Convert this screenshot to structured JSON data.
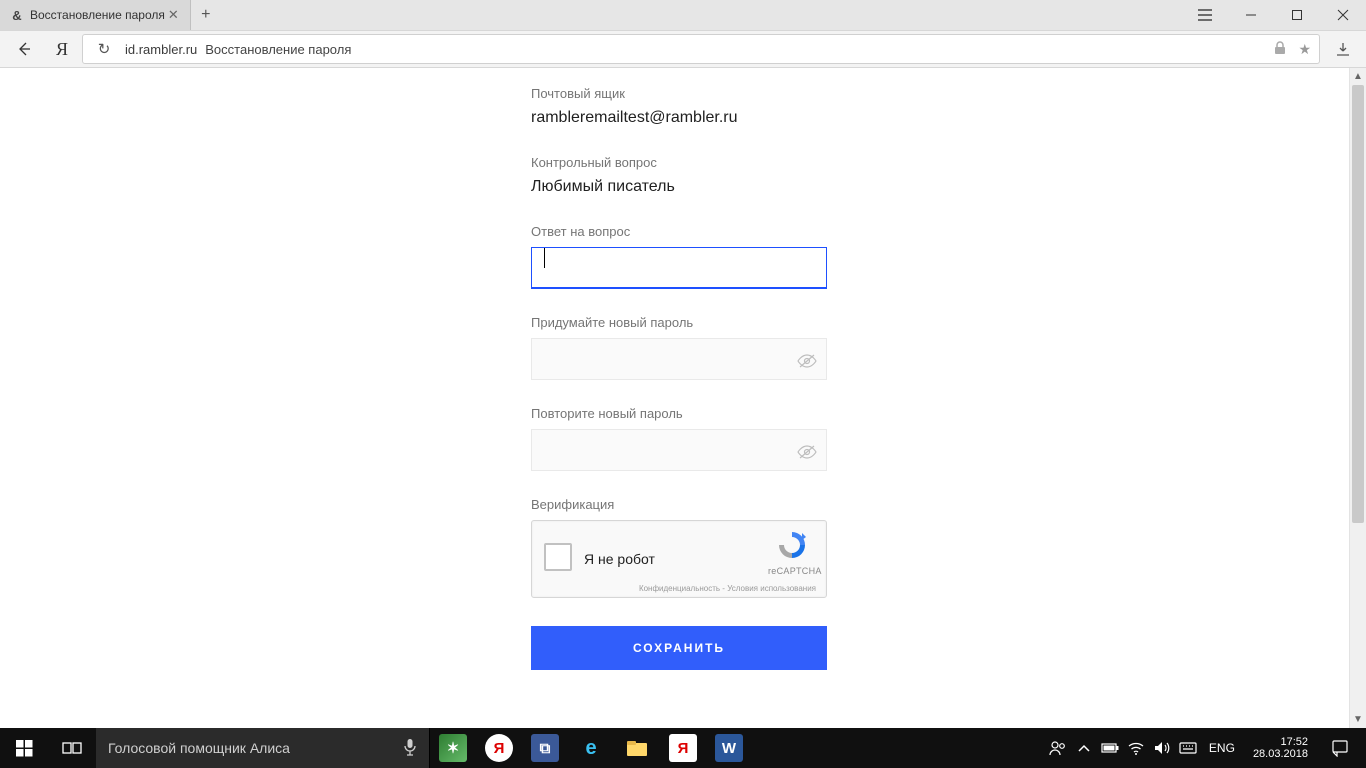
{
  "browser": {
    "tab_title": "Восстановление пароля",
    "domain": "id.rambler.ru",
    "page_title": "Восстановление пароля"
  },
  "form": {
    "mailbox_label": "Почтовый ящик",
    "mailbox_value": "rambleremailtest@rambler.ru",
    "question_label": "Контрольный вопрос",
    "question_value": "Любимый писатель",
    "answer_label": "Ответ на вопрос",
    "answer_value": "",
    "newpass_label": "Придумайте новый пароль",
    "repeatpass_label": "Повторите новый пароль",
    "verify_label": "Верификация",
    "captcha_text": "Я не робот",
    "captcha_brand": "reCAPTCHA",
    "captcha_fine": "Конфиденциальность - Условия использования",
    "submit_label": "СОХРАНИТЬ"
  },
  "taskbar": {
    "search_placeholder": "Голосовой помощник Алиса",
    "lang": "ENG",
    "time": "17:52",
    "date": "28.03.2018"
  }
}
